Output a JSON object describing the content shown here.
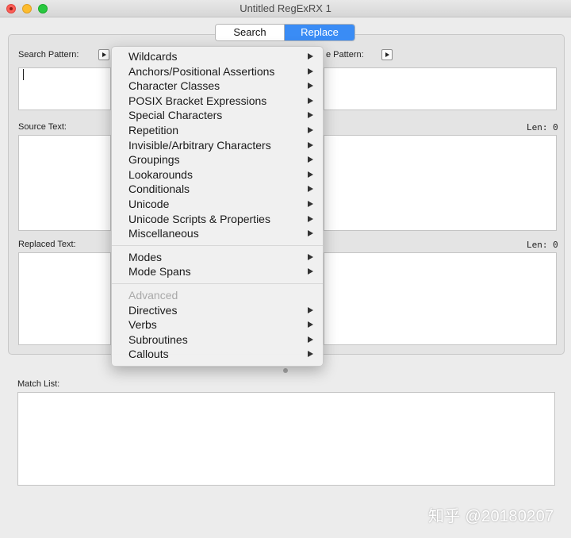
{
  "window": {
    "title": "Untitled RegExRX 1"
  },
  "mode_tabs": [
    {
      "label": "Search",
      "selected": false
    },
    {
      "label": "Replace",
      "selected": true
    }
  ],
  "labels": {
    "search_pattern": "Search Pattern:",
    "replace_pattern": "e Pattern:",
    "source_text": "Source Text:",
    "replaced_text": "Replaced Text:",
    "match_list": "Match List:",
    "source_len": "Len: 0",
    "replaced_len": "Len: 0"
  },
  "menu": {
    "groups": [
      [
        {
          "label": "Wildcards",
          "submenu": true
        },
        {
          "label": "Anchors/Positional Assertions",
          "submenu": true
        },
        {
          "label": "Character Classes",
          "submenu": true
        },
        {
          "label": "POSIX Bracket Expressions",
          "submenu": true
        },
        {
          "label": "Special Characters",
          "submenu": true
        },
        {
          "label": "Repetition",
          "submenu": true
        },
        {
          "label": "Invisible/Arbitrary Characters",
          "submenu": true
        },
        {
          "label": "Groupings",
          "submenu": true
        },
        {
          "label": "Lookarounds",
          "submenu": true
        },
        {
          "label": "Conditionals",
          "submenu": true
        },
        {
          "label": "Unicode",
          "submenu": true
        },
        {
          "label": "Unicode Scripts & Properties",
          "submenu": true
        },
        {
          "label": "Miscellaneous",
          "submenu": true
        }
      ],
      [
        {
          "label": "Modes",
          "submenu": true
        },
        {
          "label": "Mode Spans",
          "submenu": true
        }
      ],
      [
        {
          "label": "Advanced",
          "submenu": false,
          "disabled": true
        },
        {
          "label": "Directives",
          "submenu": true
        },
        {
          "label": "Verbs",
          "submenu": true
        },
        {
          "label": "Subroutines",
          "submenu": true
        },
        {
          "label": "Callouts",
          "submenu": true
        }
      ]
    ]
  },
  "watermark": "知乎 @20180207",
  "colors": {
    "accent": "#3a8cf5",
    "close": "#fc5f57",
    "minimize": "#fdbc2e",
    "maximize": "#29c840"
  }
}
